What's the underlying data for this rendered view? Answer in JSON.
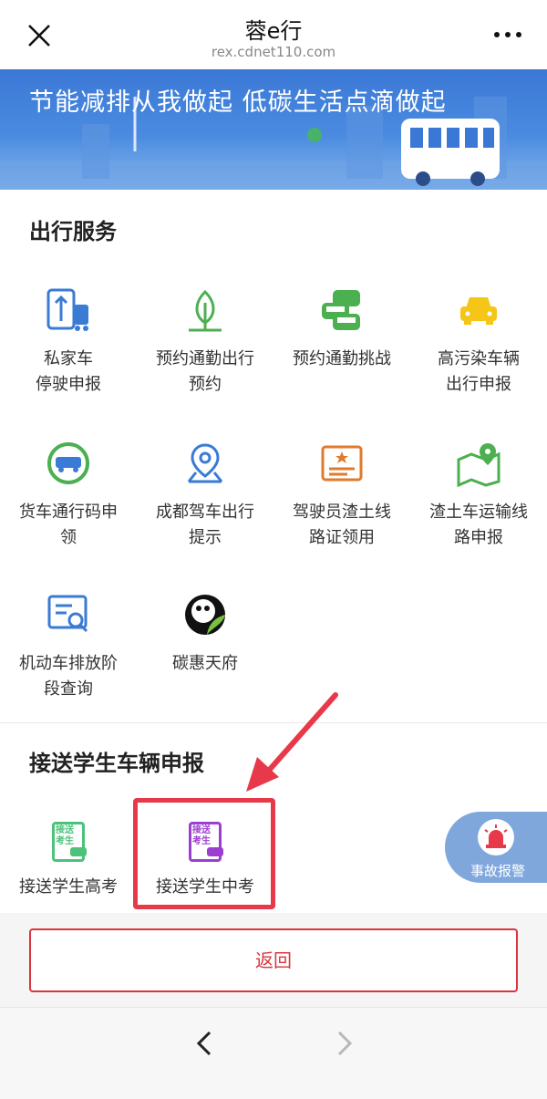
{
  "header": {
    "title": "蓉e行",
    "url": "rex.cdnet110.com"
  },
  "banner": {
    "text": "节能减排从我做起 低碳生活点滴做起"
  },
  "travel_services": {
    "title": "出行服务",
    "items": [
      {
        "line1": "私家车",
        "line2": "停驶申报",
        "icon": "parking-car-icon"
      },
      {
        "line1": "预约通勤出行",
        "line2": "预约",
        "icon": "leaf-icon"
      },
      {
        "line1": "预约通勤挑战",
        "line2": "",
        "icon": "traffic-cars-icon"
      },
      {
        "line1": "高污染车辆",
        "line2": "出行申报",
        "icon": "yellow-car-icon"
      },
      {
        "line1": "货车通行码申",
        "line2": "领",
        "icon": "truck-icon"
      },
      {
        "line1": "成都驾车出行",
        "line2": "提示",
        "icon": "location-pin-icon"
      },
      {
        "line1": "驾驶员渣土线",
        "line2": "路证领用",
        "icon": "id-card-icon"
      },
      {
        "line1": "渣土车运输线",
        "line2": "路申报",
        "icon": "map-route-icon"
      },
      {
        "line1": "机动车排放阶",
        "line2": "段查询",
        "icon": "search-document-icon"
      },
      {
        "line1": "碳惠天府",
        "line2": "",
        "icon": "panda-logo-icon"
      }
    ]
  },
  "student_transport": {
    "title": "接送学生车辆申报",
    "items": [
      {
        "label": "接送学生高考",
        "badge_line1": "接送",
        "badge_line2": "考生",
        "icon": "exam-car-icon"
      },
      {
        "label": "接送学生中考",
        "badge_line1": "接送",
        "badge_line2": "考生",
        "icon": "exam-car-icon"
      }
    ]
  },
  "float_button": {
    "label": "事故报警"
  },
  "return_button": {
    "label": "返回"
  },
  "colors": {
    "banner": "#3b78d6",
    "icon_blue": "#3a7bd5",
    "icon_green": "#4caf50",
    "accent_red": "#e8394a"
  }
}
